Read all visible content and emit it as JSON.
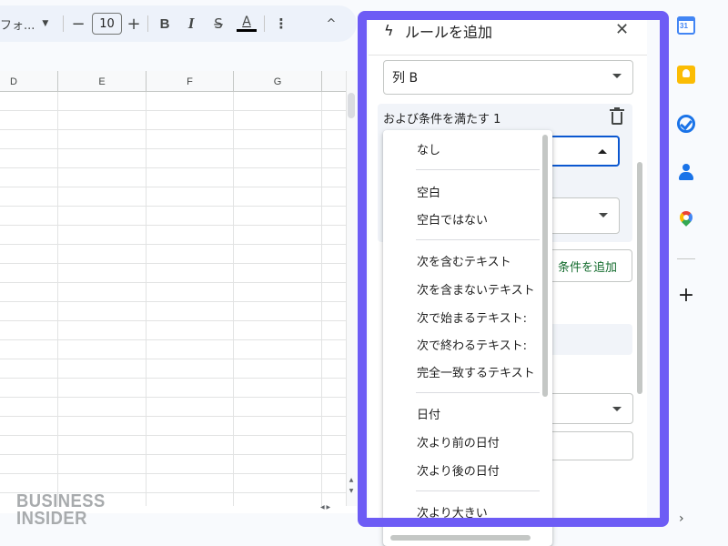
{
  "toolbar": {
    "font_name": "フォ...",
    "minus": "−",
    "font_size": "10",
    "plus": "+",
    "bold": "B",
    "italic": "I",
    "strikethrough": "S̶",
    "text_color": "A",
    "more": "⋮",
    "collapse": "^"
  },
  "grid": {
    "columns": [
      "D",
      "E",
      "F",
      "G"
    ]
  },
  "watermark": {
    "line1": "BUSINESS",
    "line2": "INSIDER"
  },
  "panel": {
    "title": "ルールを追加",
    "close": "✕",
    "column_select": "列 B",
    "condition_label": "および条件を満たす 1",
    "add_condition": "条件を追加"
  },
  "dropdown": {
    "items": [
      "なし",
      "空白",
      "空白ではない",
      "次を含むテキスト",
      "次を含まないテキスト",
      "次で始まるテキスト:",
      "次で終わるテキスト:",
      "完全一致するテキスト",
      "日付",
      "次より前の日付",
      "次より後の日付",
      "次より大きい"
    ]
  },
  "right_rail": {
    "calendar_day": "31",
    "add": "+",
    "expand": "›"
  },
  "icons": [
    "bolt-icon",
    "close-icon",
    "trash-icon",
    "caret-down-icon",
    "caret-up-icon",
    "calendar-icon",
    "keep-icon",
    "tasks-icon",
    "contacts-icon",
    "maps-icon",
    "add-icon",
    "chevron-right-icon"
  ],
  "colors": {
    "highlight": "#6d5cf5",
    "focus_blue": "#0b57d0",
    "add_condition_green": "#146c2e"
  }
}
